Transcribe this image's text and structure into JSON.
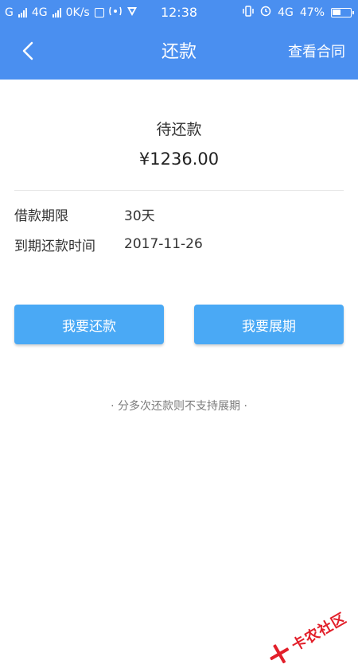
{
  "status_bar": {
    "carrier_1": "G",
    "carrier_2": "4G",
    "speed": "0K/s",
    "icon_sim": "sim-card-icon",
    "icon_hotspot": "hotspot-icon",
    "icon_shield": "shield-icon",
    "time": "12:38",
    "icon_vibrate": "vibrate-icon",
    "icon_alarm": "alarm-icon",
    "network_label": "4G",
    "battery": "47%",
    "battery_level": 0.47
  },
  "header": {
    "back_icon": "back-chevron-icon",
    "title": "还款",
    "right_link": "查看合同"
  },
  "main": {
    "pending_label": "待还款",
    "amount": "¥1236.00",
    "details": [
      {
        "label": "借款期限",
        "value": "30天"
      },
      {
        "label": "到期还款时间",
        "value": "2017-11-26"
      }
    ],
    "buttons": {
      "repay": "我要还款",
      "extend": "我要展期"
    },
    "note": "· 分多次还款则不支持展期 ·"
  },
  "watermark": {
    "text": "卡农社区",
    "icon": "kanong-logo-icon"
  },
  "colors": {
    "header_bg": "#4a8ff0",
    "button_bg": "#4aa9f5",
    "watermark": "#e1141f"
  }
}
